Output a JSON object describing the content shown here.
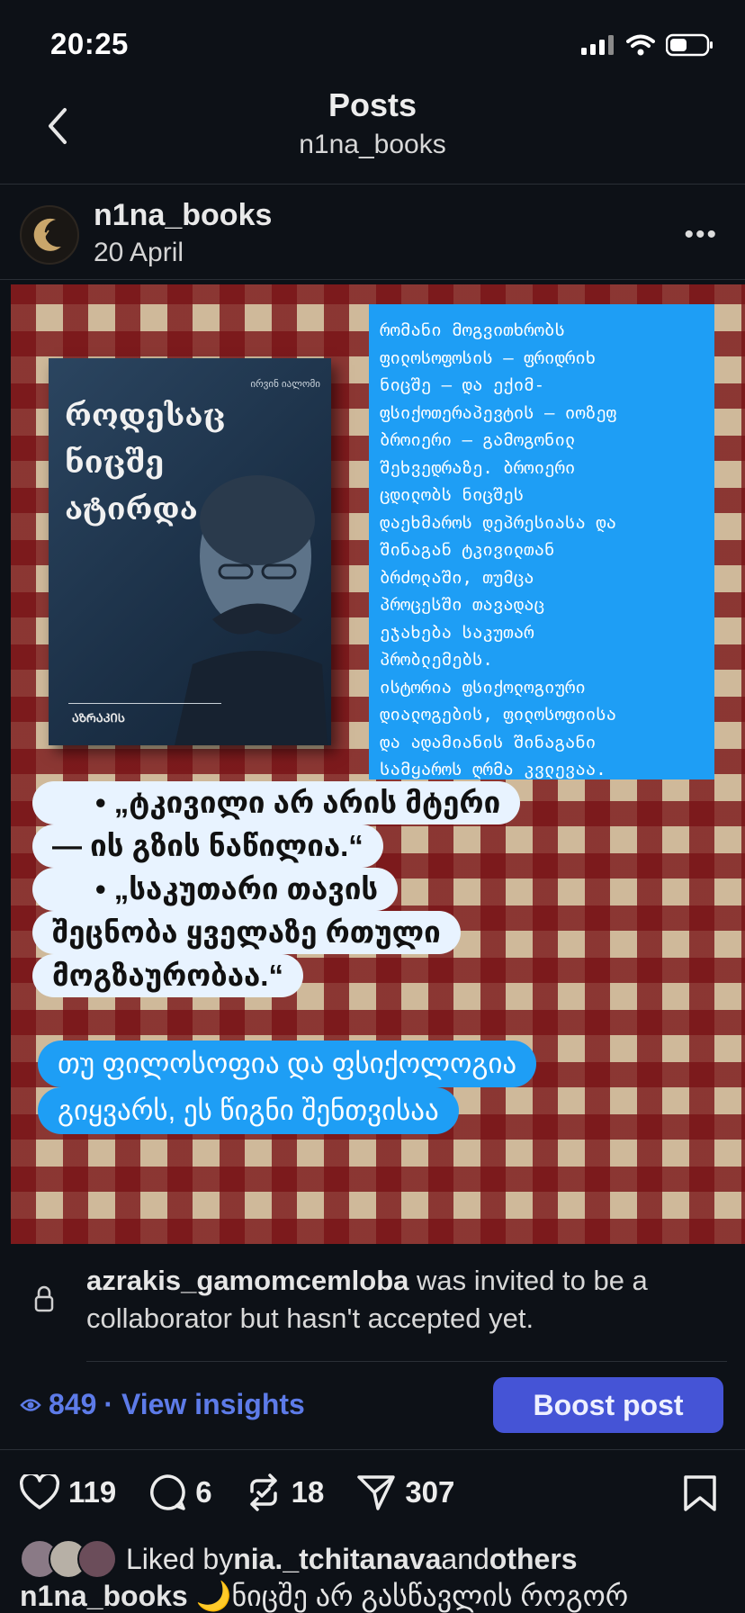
{
  "status_bar": {
    "time": "20:25"
  },
  "header": {
    "title": "Posts",
    "subtitle": "n1na_books"
  },
  "post": {
    "username": "n1na_books",
    "date": "20 April",
    "image": {
      "book_title_lines": [
        "როდესაც",
        "ნიცშე",
        "ატირდა"
      ],
      "book_author": "ირვინ იალომი",
      "book_publisher": "ᲐᲖᲠᲐᲙᲘᲡ",
      "blue_box_lines": [
        "რომანი მოგვითხრობს",
        "ფილოსოფოსის — ფრიდრიხ",
        "ნიცშე — და ექიმ-",
        "ფსიქოთერაპევტის — იოზეფ",
        "ბროიერი — გამოგონილ",
        "შეხვედრაზე. ბროიერი",
        "ცდილობს ნიცშეს",
        "დაეხმაროს დეპრესიასა და",
        "შინაგან ტკივილთან",
        "ბრძოლაში, თუმცა",
        "პროცესში თავადაც",
        "ეჯახება საკუთარ",
        "პრობლემებს.",
        "ისტორია ფსიქოლოგიური",
        "დიალოგების, ფილოსოფიისა",
        "და ადამიანის შინაგანი",
        "სამყაროს ღრმა კვლევაა."
      ],
      "quote_lines": [
        "•  „ტკივილი არ არის მტერი",
        "— ის გზის ნაწილია.“",
        "•  „საკუთარი თავის",
        "შეცნობა ყველაზე რთული",
        "მოგზაურობაა.“"
      ],
      "cta_lines": [
        "თუ ფილოსოფია და ფსიქოლოგია",
        "გიყვარს, ეს წიგნი შენთვისაა"
      ]
    },
    "collaborator": {
      "name": "azrakis_gamomcemloba",
      "message": " was invited to be a collaborator but hasn't accepted yet."
    },
    "insights": {
      "views": "849",
      "link": "· View insights"
    },
    "boost_label": "Boost post",
    "actions": {
      "likes": "119",
      "comments": "6",
      "reposts": "18",
      "shares": "307"
    },
    "liked_by": {
      "prefix": "Liked by ",
      "user": "nia._tchitanava",
      "middle": " and ",
      "others": "others"
    },
    "caption": {
      "user": "n1na_books",
      "text": " 🌙ნიცშე არ გასწავლის როგორ"
    }
  },
  "colors": {
    "accent_blue": "#1e9ef5",
    "boost_bg": "#4554d6",
    "insights": "#5d7be8",
    "background": "#0d1117"
  },
  "icons": [
    "back-chevron-icon",
    "signal-icon",
    "wifi-icon",
    "battery-icon",
    "more-icon",
    "lock-icon",
    "eye-icon",
    "heart-icon",
    "comment-icon",
    "repost-icon",
    "share-icon",
    "bookmark-icon"
  ]
}
